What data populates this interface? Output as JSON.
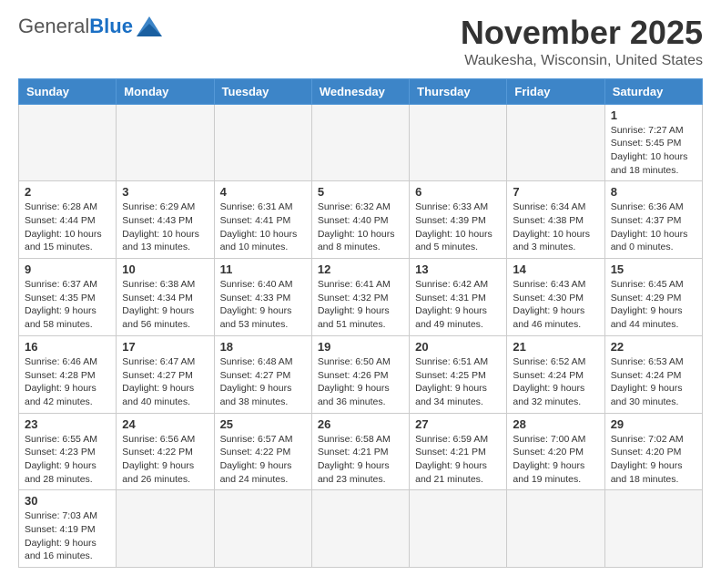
{
  "header": {
    "logo_general": "General",
    "logo_blue": "Blue",
    "month": "November 2025",
    "location": "Waukesha, Wisconsin, United States"
  },
  "weekdays": [
    "Sunday",
    "Monday",
    "Tuesday",
    "Wednesday",
    "Thursday",
    "Friday",
    "Saturday"
  ],
  "weeks": [
    [
      {
        "day": "",
        "info": ""
      },
      {
        "day": "",
        "info": ""
      },
      {
        "day": "",
        "info": ""
      },
      {
        "day": "",
        "info": ""
      },
      {
        "day": "",
        "info": ""
      },
      {
        "day": "",
        "info": ""
      },
      {
        "day": "1",
        "info": "Sunrise: 7:27 AM\nSunset: 5:45 PM\nDaylight: 10 hours\nand 18 minutes."
      }
    ],
    [
      {
        "day": "2",
        "info": "Sunrise: 6:28 AM\nSunset: 4:44 PM\nDaylight: 10 hours\nand 15 minutes."
      },
      {
        "day": "3",
        "info": "Sunrise: 6:29 AM\nSunset: 4:43 PM\nDaylight: 10 hours\nand 13 minutes."
      },
      {
        "day": "4",
        "info": "Sunrise: 6:31 AM\nSunset: 4:41 PM\nDaylight: 10 hours\nand 10 minutes."
      },
      {
        "day": "5",
        "info": "Sunrise: 6:32 AM\nSunset: 4:40 PM\nDaylight: 10 hours\nand 8 minutes."
      },
      {
        "day": "6",
        "info": "Sunrise: 6:33 AM\nSunset: 4:39 PM\nDaylight: 10 hours\nand 5 minutes."
      },
      {
        "day": "7",
        "info": "Sunrise: 6:34 AM\nSunset: 4:38 PM\nDaylight: 10 hours\nand 3 minutes."
      },
      {
        "day": "8",
        "info": "Sunrise: 6:36 AM\nSunset: 4:37 PM\nDaylight: 10 hours\nand 0 minutes."
      }
    ],
    [
      {
        "day": "9",
        "info": "Sunrise: 6:37 AM\nSunset: 4:35 PM\nDaylight: 9 hours\nand 58 minutes."
      },
      {
        "day": "10",
        "info": "Sunrise: 6:38 AM\nSunset: 4:34 PM\nDaylight: 9 hours\nand 56 minutes."
      },
      {
        "day": "11",
        "info": "Sunrise: 6:40 AM\nSunset: 4:33 PM\nDaylight: 9 hours\nand 53 minutes."
      },
      {
        "day": "12",
        "info": "Sunrise: 6:41 AM\nSunset: 4:32 PM\nDaylight: 9 hours\nand 51 minutes."
      },
      {
        "day": "13",
        "info": "Sunrise: 6:42 AM\nSunset: 4:31 PM\nDaylight: 9 hours\nand 49 minutes."
      },
      {
        "day": "14",
        "info": "Sunrise: 6:43 AM\nSunset: 4:30 PM\nDaylight: 9 hours\nand 46 minutes."
      },
      {
        "day": "15",
        "info": "Sunrise: 6:45 AM\nSunset: 4:29 PM\nDaylight: 9 hours\nand 44 minutes."
      }
    ],
    [
      {
        "day": "16",
        "info": "Sunrise: 6:46 AM\nSunset: 4:28 PM\nDaylight: 9 hours\nand 42 minutes."
      },
      {
        "day": "17",
        "info": "Sunrise: 6:47 AM\nSunset: 4:27 PM\nDaylight: 9 hours\nand 40 minutes."
      },
      {
        "day": "18",
        "info": "Sunrise: 6:48 AM\nSunset: 4:27 PM\nDaylight: 9 hours\nand 38 minutes."
      },
      {
        "day": "19",
        "info": "Sunrise: 6:50 AM\nSunset: 4:26 PM\nDaylight: 9 hours\nand 36 minutes."
      },
      {
        "day": "20",
        "info": "Sunrise: 6:51 AM\nSunset: 4:25 PM\nDaylight: 9 hours\nand 34 minutes."
      },
      {
        "day": "21",
        "info": "Sunrise: 6:52 AM\nSunset: 4:24 PM\nDaylight: 9 hours\nand 32 minutes."
      },
      {
        "day": "22",
        "info": "Sunrise: 6:53 AM\nSunset: 4:24 PM\nDaylight: 9 hours\nand 30 minutes."
      }
    ],
    [
      {
        "day": "23",
        "info": "Sunrise: 6:55 AM\nSunset: 4:23 PM\nDaylight: 9 hours\nand 28 minutes."
      },
      {
        "day": "24",
        "info": "Sunrise: 6:56 AM\nSunset: 4:22 PM\nDaylight: 9 hours\nand 26 minutes."
      },
      {
        "day": "25",
        "info": "Sunrise: 6:57 AM\nSunset: 4:22 PM\nDaylight: 9 hours\nand 24 minutes."
      },
      {
        "day": "26",
        "info": "Sunrise: 6:58 AM\nSunset: 4:21 PM\nDaylight: 9 hours\nand 23 minutes."
      },
      {
        "day": "27",
        "info": "Sunrise: 6:59 AM\nSunset: 4:21 PM\nDaylight: 9 hours\nand 21 minutes."
      },
      {
        "day": "28",
        "info": "Sunrise: 7:00 AM\nSunset: 4:20 PM\nDaylight: 9 hours\nand 19 minutes."
      },
      {
        "day": "29",
        "info": "Sunrise: 7:02 AM\nSunset: 4:20 PM\nDaylight: 9 hours\nand 18 minutes."
      }
    ],
    [
      {
        "day": "30",
        "info": "Sunrise: 7:03 AM\nSunset: 4:19 PM\nDaylight: 9 hours\nand 16 minutes."
      },
      {
        "day": "",
        "info": ""
      },
      {
        "day": "",
        "info": ""
      },
      {
        "day": "",
        "info": ""
      },
      {
        "day": "",
        "info": ""
      },
      {
        "day": "",
        "info": ""
      },
      {
        "day": "",
        "info": ""
      }
    ]
  ]
}
